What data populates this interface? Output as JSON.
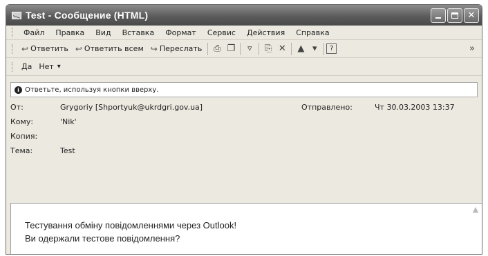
{
  "window": {
    "title": "Test - Сообщение (HTML)"
  },
  "menu": [
    "Файл",
    "Правка",
    "Вид",
    "Вставка",
    "Формат",
    "Сервис",
    "Действия",
    "Справка"
  ],
  "toolbar": {
    "reply": "Ответить",
    "reply_all": "Ответить всем",
    "forward": "Переслать",
    "overflow": "»"
  },
  "voting": {
    "yes": "Да",
    "no": "Нет"
  },
  "infobar": {
    "text": "Ответьте, используя кнопки вверху."
  },
  "headers": {
    "from_label": "От:",
    "from": "Grygoriy [Shportyuk@ukrdgri.gov.ua]",
    "sent_label": "Отправлено:",
    "sent": "Чт 30.03.2003 13:37",
    "to_label": "Кому:",
    "to": "'Nik'",
    "cc_label": "Копия:",
    "subject_label": "Тема:",
    "subject": "Test"
  },
  "body": {
    "line1": "Тестування обміну повідомленнями через Outlook!",
    "line2": "Ви одержали тестове повідомлення?"
  }
}
